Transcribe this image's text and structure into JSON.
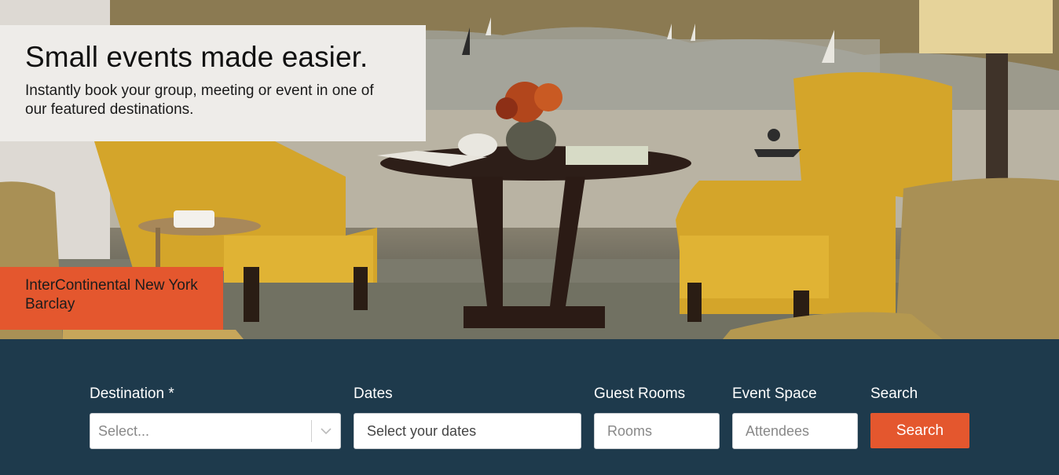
{
  "hero": {
    "headline": "Small events made easier.",
    "subline": "Instantly book your group, meeting or event in one of our featured destinations.",
    "hotel_name": "InterContinental New York Barclay"
  },
  "search": {
    "destination": {
      "label": "Destination *",
      "placeholder": "Select...",
      "icon": "chevron-down-icon"
    },
    "dates": {
      "label": "Dates",
      "placeholder": "Select your dates"
    },
    "guest_rooms": {
      "label": "Guest Rooms",
      "placeholder": "Rooms"
    },
    "event_space": {
      "label": "Event Space",
      "placeholder": "Attendees"
    },
    "submit": {
      "label": "Search",
      "button": "Search"
    }
  },
  "colors": {
    "panel_bg": "#1e3a4c",
    "accent": "#e4572e",
    "headline_box": "#eeece9"
  }
}
